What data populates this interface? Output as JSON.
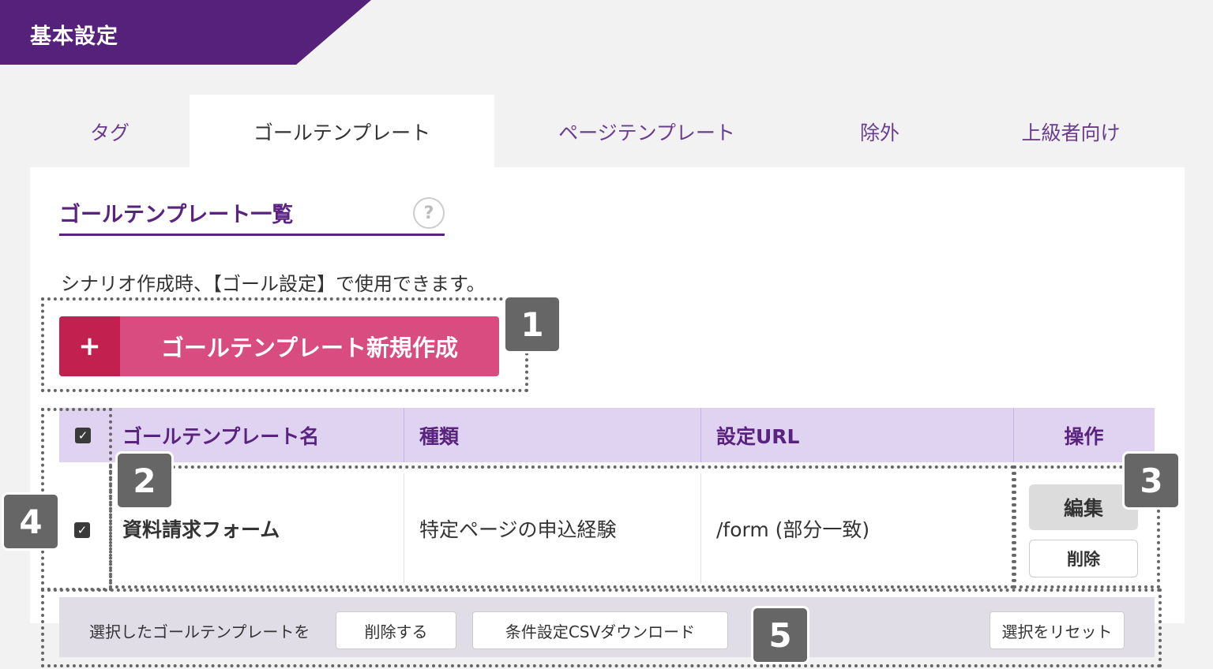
{
  "header": {
    "title": "基本設定"
  },
  "tabs": [
    {
      "label": "タグ",
      "active": false
    },
    {
      "label": "ゴールテンプレート",
      "active": true
    },
    {
      "label": "ページテンプレート",
      "active": false
    },
    {
      "label": "除外",
      "active": false
    },
    {
      "label": "上級者向け",
      "active": false
    }
  ],
  "section": {
    "title": "ゴールテンプレート一覧",
    "help_icon": "?",
    "description": "シナリオ作成時、【ゴール設定】で使用できます。"
  },
  "create_button": {
    "icon": "+",
    "label": "ゴールテンプレート新規作成"
  },
  "table": {
    "headers": {
      "name": "ゴールテンプレート名",
      "type": "種類",
      "url": "設定URL",
      "actions": "操作"
    },
    "header_checkbox": "✓",
    "rows": [
      {
        "checked": "✓",
        "name": "資料請求フォーム",
        "type": "特定ページの申込経験",
        "url": "/form (部分一致)",
        "edit_label": "編集",
        "delete_label": "削除"
      }
    ]
  },
  "bulk_actions": {
    "label": "選択したゴールテンプレートを",
    "delete_label": "削除する",
    "csv_label": "条件設定CSVダウンロード",
    "reset_label": "選択をリセット"
  },
  "callouts": [
    "1",
    "2",
    "3",
    "4",
    "5"
  ],
  "colors": {
    "brand_purple": "#56217a",
    "accent_pink": "#d94c80",
    "header_lavender": "#e0d3f2"
  }
}
